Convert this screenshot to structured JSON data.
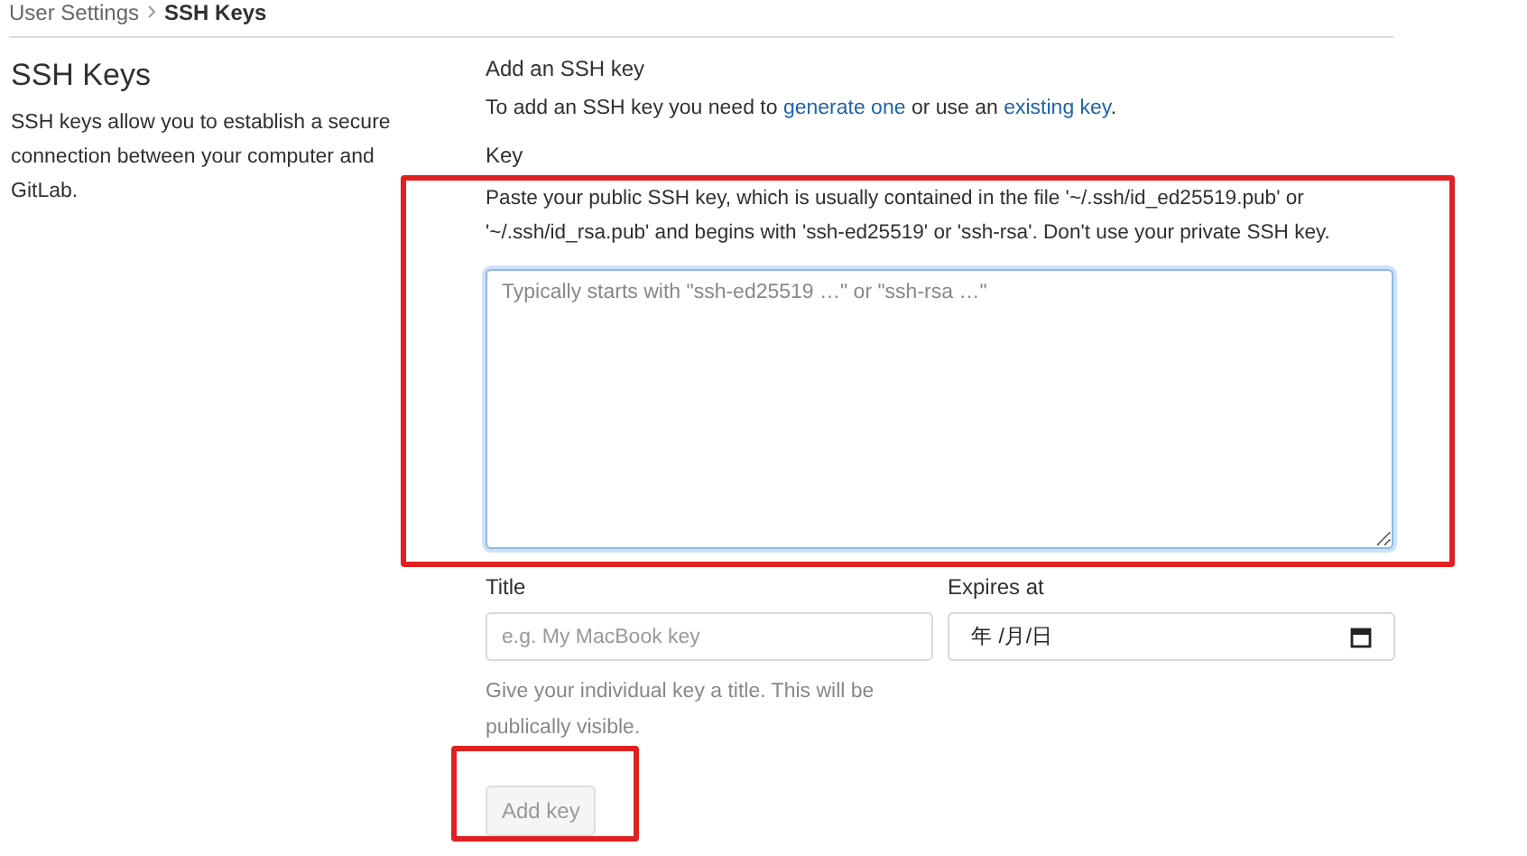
{
  "breadcrumb": [
    {
      "label": "User Settings",
      "current": false
    },
    {
      "label": "SSH Keys",
      "current": true
    }
  ],
  "sidebar": {
    "title": "SSH Keys",
    "description": "SSH keys allow you to establish a secure connection between your computer and GitLab."
  },
  "form": {
    "heading": "Add an SSH key",
    "intro": [
      {
        "kind": "text",
        "text": "To add an SSH key you need to "
      },
      {
        "kind": "link",
        "text": "generate one"
      },
      {
        "kind": "text",
        "text": " or use an "
      },
      {
        "kind": "link",
        "text": "existing key"
      },
      {
        "kind": "text",
        "text": "."
      }
    ],
    "key": {
      "label": "Key",
      "help": "Paste your public SSH key, which is usually contained in the file '~/.ssh/id_ed25519.pub' or '~/.ssh/id_rsa.pub' and begins with 'ssh-ed25519' or 'ssh-rsa'. Don't use your private SSH key.",
      "placeholder": "Typically starts with \"ssh-ed25519 …\" or \"ssh-rsa …\"",
      "focused": true
    },
    "title": {
      "label": "Title",
      "placeholder": "e.g. My MacBook key",
      "help": "Give your individual key a title. This will be publically visible."
    },
    "expires": {
      "label": "Expires at",
      "value": "年 /月/日"
    },
    "submit": {
      "label": "Add key",
      "disabled": true
    }
  },
  "annotations": [
    {
      "kind": "rectangle"
    },
    {
      "kind": "rectangle"
    }
  ]
}
